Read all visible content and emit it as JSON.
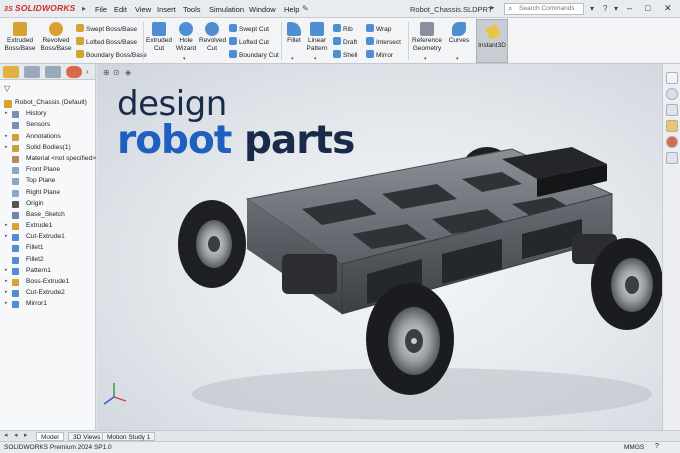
{
  "titlebar": {
    "brand": "SOLIDWORKS",
    "brand_mark": "3S",
    "menus": [
      "File",
      "Edit",
      "View",
      "Insert",
      "Tools",
      "Simulation",
      "Window",
      "Help"
    ],
    "document_title": "Robot_Chassis.SLDPRT",
    "search_placeholder": "Search Commands"
  },
  "ribbon": {
    "big_buttons": [
      {
        "line1": "Extruded",
        "line2": "Boss/Base",
        "color": "#d9a032"
      },
      {
        "line1": "Revolved",
        "line2": "Boss/Base",
        "color": "#d9a032"
      },
      {
        "line1": "Extruded",
        "line2": "Cut",
        "color": "#4f8fd1"
      },
      {
        "line1": "Hole",
        "line2": "Wizard",
        "color": "#4f8fd1"
      },
      {
        "line1": "Revolved",
        "line2": "Cut",
        "color": "#4f8fd1"
      },
      {
        "line1": "Fillet",
        "line2": "",
        "color": "#4f8fd1"
      },
      {
        "line1": "Linear",
        "line2": "Pattern",
        "color": "#4f8fd1"
      },
      {
        "line1": "Reference",
        "line2": "Geometry",
        "color": "#8a8fa0"
      },
      {
        "line1": "Curves",
        "line2": "",
        "color": "#4f8fd1"
      }
    ],
    "boss_small": [
      "Swept Boss/Base",
      "Lofted Boss/Base",
      "Boundary Boss/Base"
    ],
    "cut_small": [
      "Swept Cut",
      "Lofted Cut",
      "Boundary Cut"
    ],
    "feature_small_a": [
      "Rib",
      "Draft",
      "Shell"
    ],
    "feature_small_b": [
      "Wrap",
      "Intersect",
      "Mirror"
    ],
    "instant3d_label": "Instant3D"
  },
  "feature_tree": {
    "root": "Robot_Chassis  (Default)",
    "items": [
      {
        "label": "History",
        "expandable": true,
        "icon_color": "#7a8fb0"
      },
      {
        "label": "Sensors",
        "expandable": false,
        "icon_color": "#7a8fb0"
      },
      {
        "label": "Annotations",
        "expandable": true,
        "icon_color": "#caa23a"
      },
      {
        "label": "Solid Bodies(1)",
        "expandable": true,
        "icon_color": "#caa23a"
      },
      {
        "label": "Material <not specified>",
        "expandable": false,
        "icon_color": "#b58a5a"
      },
      {
        "label": "Front Plane",
        "expandable": false,
        "icon_color": "#8aa6c8"
      },
      {
        "label": "Top Plane",
        "expandable": false,
        "icon_color": "#8aa6c8"
      },
      {
        "label": "Right Plane",
        "expandable": false,
        "icon_color": "#8aa6c8"
      },
      {
        "label": "Origin",
        "expandable": false,
        "icon_color": "#555555"
      },
      {
        "label": "Base_Sketch",
        "expandable": false,
        "icon_color": "#6f86a8"
      },
      {
        "label": "Extrude1",
        "expandable": true,
        "icon_color": "#d9a032"
      },
      {
        "label": "Cut-Extrude1",
        "expandable": true,
        "icon_color": "#4f8fd1"
      },
      {
        "label": "Fillet1",
        "expandable": false,
        "icon_color": "#4f8fd1"
      },
      {
        "label": "Fillet2",
        "expandable": false,
        "icon_color": "#4f8fd1"
      },
      {
        "label": "Pattern1",
        "expandable": true,
        "icon_color": "#4f8fd1"
      },
      {
        "label": "Boss-Extrude1",
        "expandable": true,
        "icon_color": "#d9a032"
      },
      {
        "label": "Cut-Extrude2",
        "expandable": true,
        "icon_color": "#4f8fd1"
      },
      {
        "label": "Mirror1",
        "expandable": true,
        "icon_color": "#4f8fd1"
      }
    ]
  },
  "viewport": {
    "headline_line1": "design",
    "headline_word_a": "robot",
    "headline_word_b": " parts",
    "accent_color": "#1f5fbf",
    "dark_color": "#1a2b4a"
  },
  "bottom_tabs": [
    "Model",
    "3D Views",
    "Motion Study 1"
  ],
  "statusbar": {
    "product": "SOLIDWORKS Premium 2024 SP1.0",
    "units": "MMGS",
    "help": "?"
  }
}
